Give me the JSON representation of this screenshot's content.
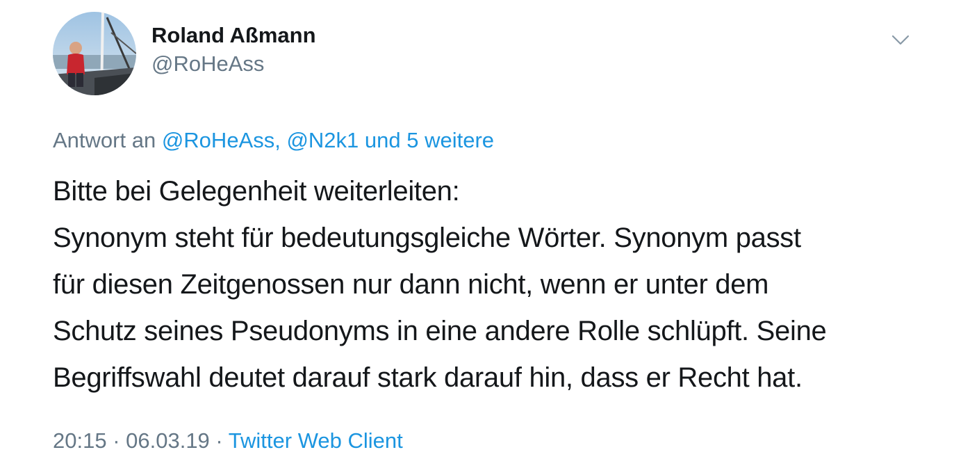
{
  "author": {
    "display_name": "Roland Aßmann",
    "handle": "@RoHeAss",
    "avatar_icon": "profile-photo"
  },
  "menu": {
    "icon": "chevron-down-icon"
  },
  "reply": {
    "prefix": "Antwort an",
    "mentions": "@RoHeAss, @N2k1 und 5 weitere"
  },
  "tweet": {
    "lines": [
      "Bitte bei Gelegenheit weiterleiten:",
      "Synonym steht für bedeutungsgleiche Wörter. Synonym passt",
      "für diesen Zeitgenossen nur dann nicht, wenn er unter dem",
      "Schutz seines Pseudonyms in eine andere Rolle schlüpft. Seine",
      "Begriffswahl deutet darauf stark darauf hin, dass er Recht hat."
    ]
  },
  "meta": {
    "timestamp": "20:15 · 06.03.19",
    "separator": " · ",
    "source": "Twitter Web Client"
  },
  "colors": {
    "text": "#14171a",
    "secondary": "#657786",
    "link": "#1b95e0"
  }
}
